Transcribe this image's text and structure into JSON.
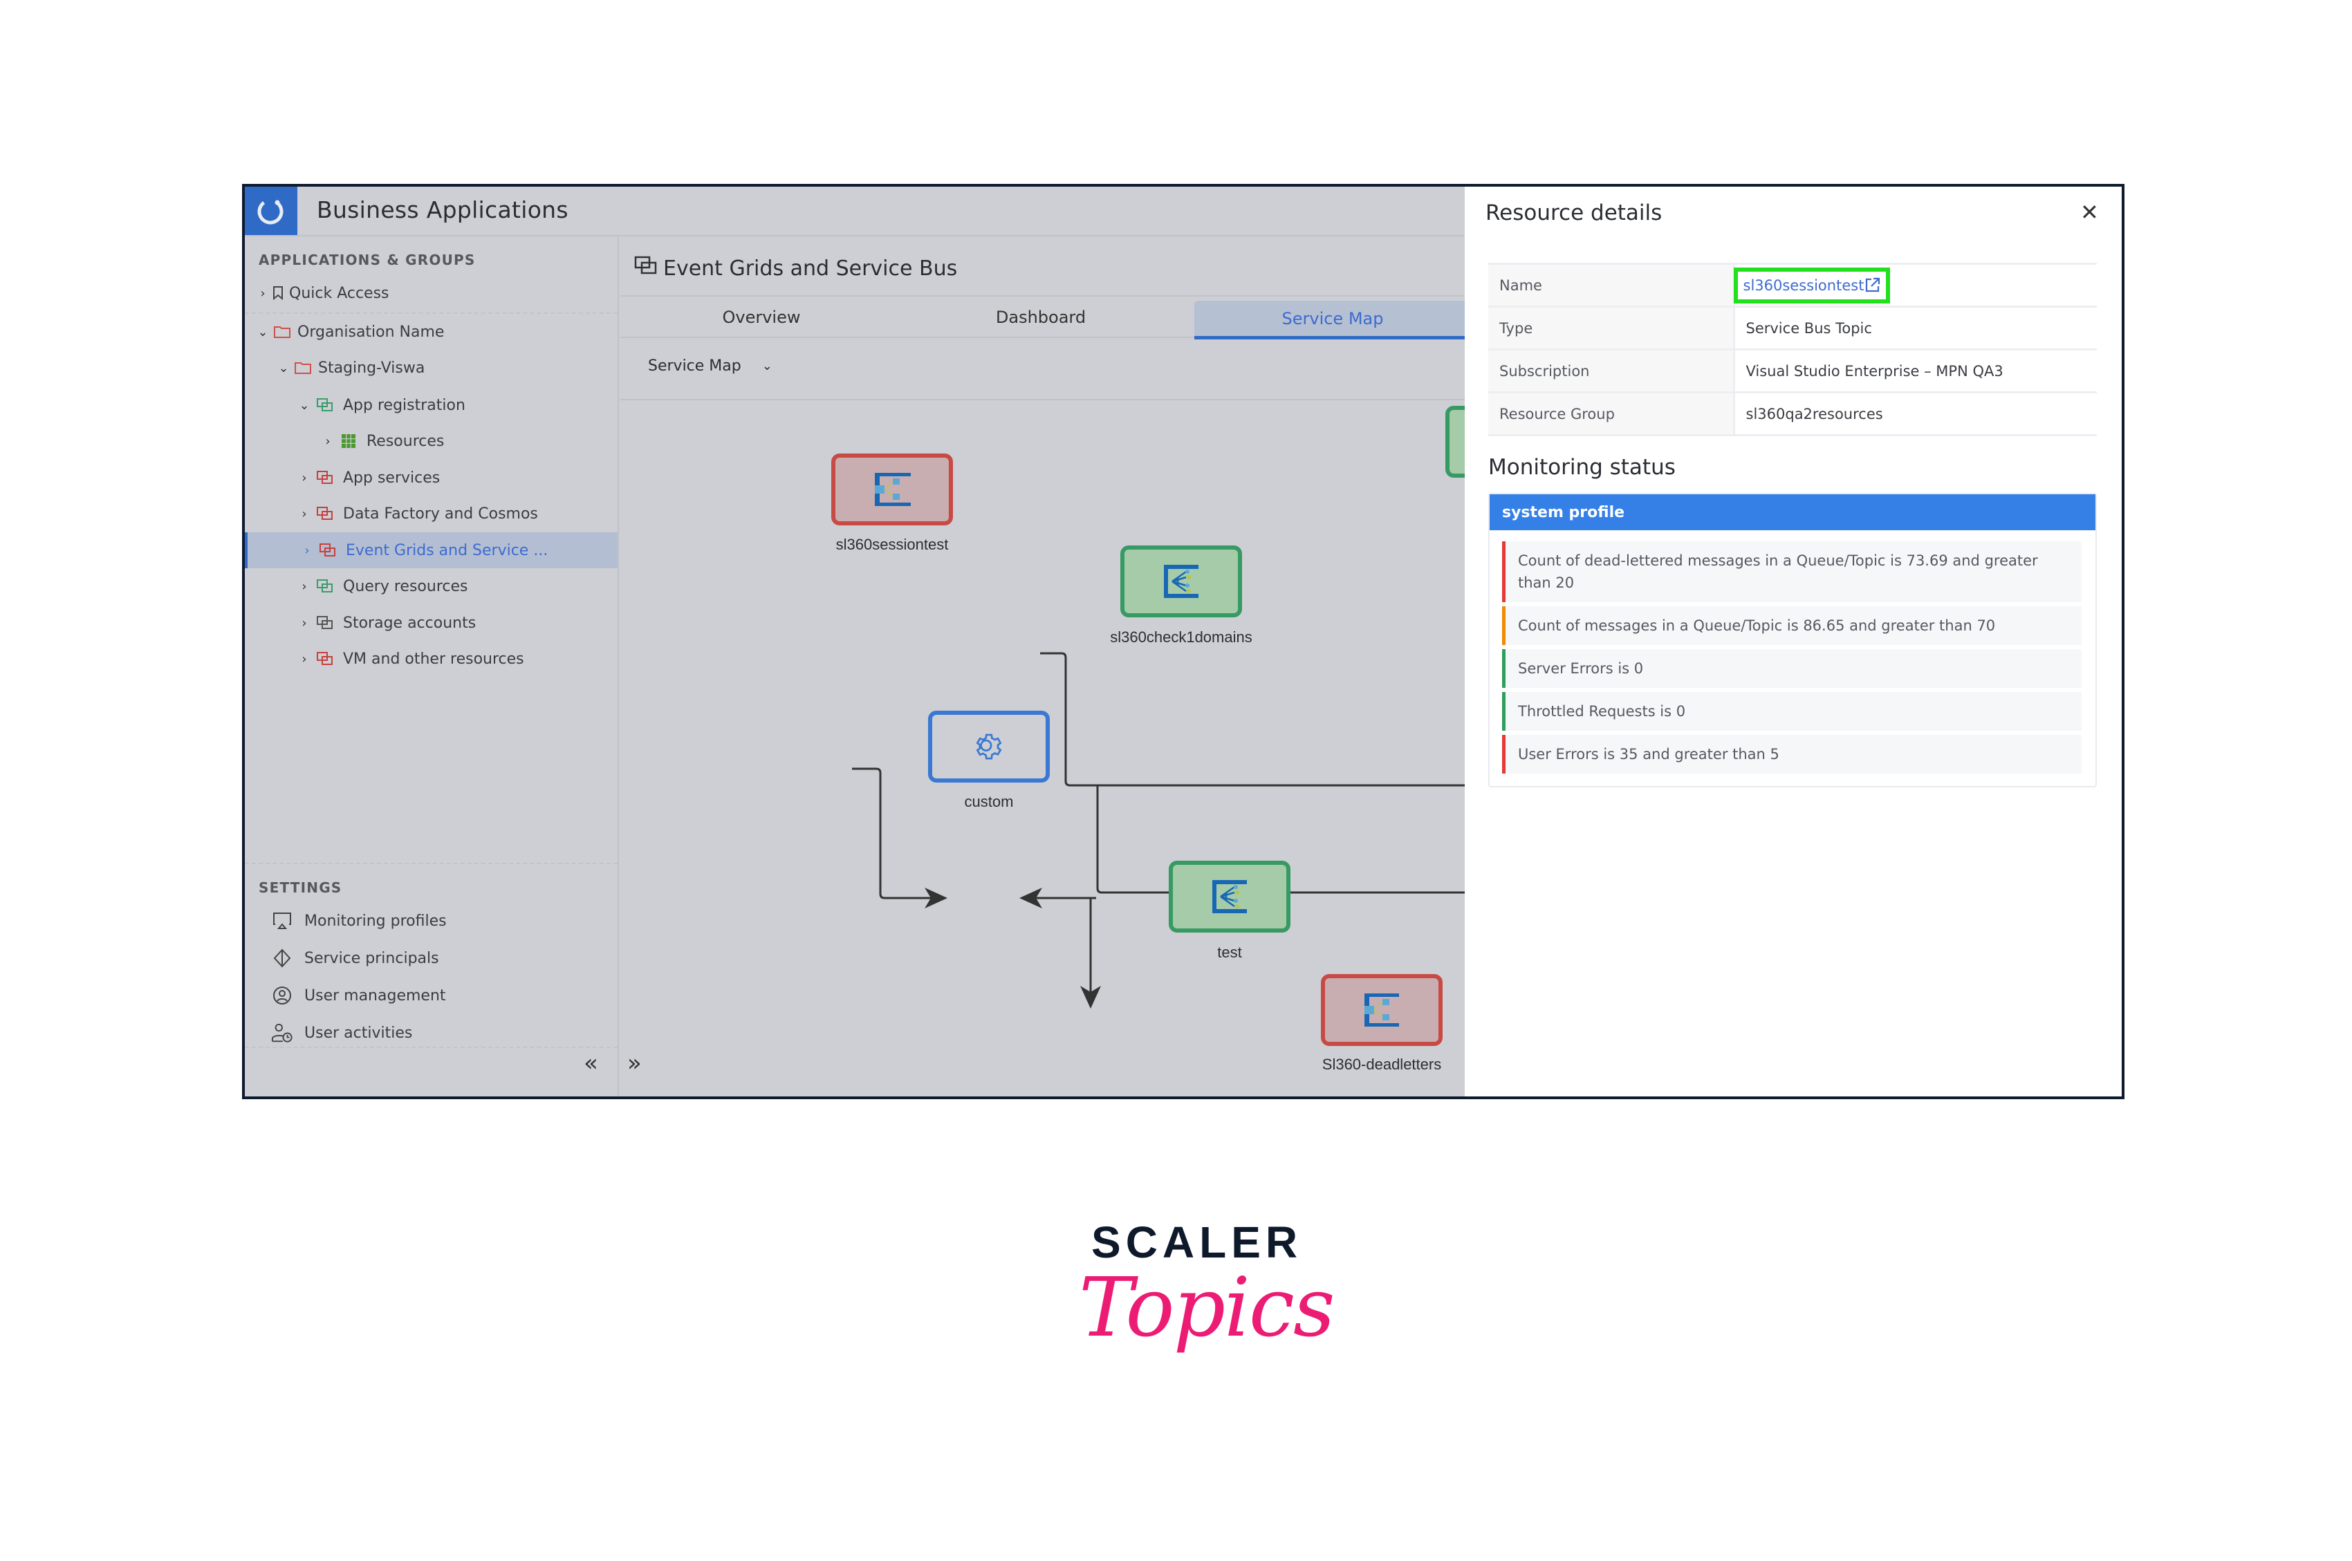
{
  "app": {
    "title": "Business Applications",
    "logo_icon": "refresh-circle-icon"
  },
  "sidebar": {
    "section_label": "APPLICATIONS & GROUPS",
    "tree": [
      {
        "label": "Quick Access",
        "icon": "bookmark-icon",
        "expanded": false,
        "level": 0
      },
      {
        "label": "Organisation Name",
        "icon": "folder-icon",
        "expanded": true,
        "level": 0
      },
      {
        "label": "Staging-Viswa",
        "icon": "folder-icon",
        "expanded": true,
        "level": 1
      },
      {
        "label": "App registration",
        "icon": "resource-group-icon",
        "status": "green",
        "expanded": true,
        "level": 2
      },
      {
        "label": "Resources",
        "icon": "grid-icon",
        "expanded": false,
        "level": 3
      },
      {
        "label": "App services",
        "icon": "resource-group-icon",
        "status": "red",
        "expanded": false,
        "level": 2
      },
      {
        "label": "Data Factory and Cosmos",
        "icon": "resource-group-icon",
        "status": "red",
        "expanded": false,
        "level": 2
      },
      {
        "label": "Event Grids and Service ...",
        "icon": "resource-group-icon",
        "status": "red",
        "expanded": false,
        "level": 2,
        "selected": true
      },
      {
        "label": "Query resources",
        "icon": "resource-group-icon",
        "status": "green",
        "expanded": false,
        "level": 2
      },
      {
        "label": "Storage accounts",
        "icon": "resource-group-icon",
        "status": "gray",
        "expanded": false,
        "level": 2
      },
      {
        "label": "VM and other resources",
        "icon": "resource-group-icon",
        "status": "red",
        "expanded": false,
        "level": 2
      }
    ],
    "settings_label": "SETTINGS",
    "settings": [
      {
        "label": "Monitoring profiles",
        "icon": "monitor-icon"
      },
      {
        "label": "Service principals",
        "icon": "diamond-icon"
      },
      {
        "label": "User management",
        "icon": "user-circle-icon"
      },
      {
        "label": "User activities",
        "icon": "user-clock-icon"
      }
    ],
    "collapse_label": "«"
  },
  "main": {
    "title": "Event Grids and Service Bus",
    "tabs": [
      {
        "label": "Overview",
        "active": false
      },
      {
        "label": "Dashboard",
        "active": false
      },
      {
        "label": "Service Map",
        "active": true
      }
    ],
    "view_select": {
      "value": "Service Map"
    },
    "expand_label": "»",
    "service_map": {
      "nodes": [
        {
          "id": "sl360sessiontest",
          "label": "sl360sessiontest",
          "kind": "service-bus-topic",
          "status": "red"
        },
        {
          "id": "sl360check1domains",
          "label": "sl360check1domains",
          "kind": "event-grid",
          "status": "green"
        },
        {
          "id": "custom",
          "label": "custom",
          "kind": "custom",
          "status": "blue"
        },
        {
          "id": "test",
          "label": "test",
          "kind": "event-grid",
          "status": "green"
        },
        {
          "id": "Sl360-deadletters",
          "label": "Sl360-deadletters",
          "kind": "service-bus-topic",
          "status": "red"
        },
        {
          "id": "offscreen",
          "label": "",
          "kind": "event-grid",
          "status": "green"
        }
      ],
      "edges": [
        {
          "from": "custom",
          "to": "test"
        },
        {
          "from": "sl360check1domains",
          "to": "test"
        },
        {
          "from": "sl360check1domains",
          "to": "Sl360-deadletters"
        }
      ]
    }
  },
  "details": {
    "title": "Resource details",
    "close_label": "✕",
    "properties": [
      {
        "key": "Name",
        "value": "sl360sessiontest",
        "link": true
      },
      {
        "key": "Type",
        "value": "Service Bus Topic"
      },
      {
        "key": "Subscription",
        "value": "Visual Studio Enterprise – MPN QA3"
      },
      {
        "key": "Resource Group",
        "value": "sl360qa2resources"
      }
    ],
    "monitoring_title": "Monitoring status",
    "profile_name": "system profile",
    "rules": [
      {
        "text": "Count of dead-lettered messages in a Queue/Topic is 73.69 and greater than 20",
        "severity": "critical",
        "color": "#e53935"
      },
      {
        "text": "Count of messages in a Queue/Topic is 86.65 and greater than 70",
        "severity": "warning",
        "color": "#f08a00"
      },
      {
        "text": "Server Errors is 0",
        "severity": "ok",
        "color": "#2e9e5e"
      },
      {
        "text": "Throttled Requests is 0",
        "severity": "ok",
        "color": "#2e9e5e"
      },
      {
        "text": "User Errors is 35 and greater than 5",
        "severity": "critical",
        "color": "#e53935"
      }
    ]
  },
  "colors": {
    "accent": "#2f6bc6",
    "profile_header": "#3580e6",
    "highlight_box": "#22e01c",
    "node_red": "#c84a45",
    "node_green": "#389a63",
    "node_blue": "#3a78d3"
  },
  "brand": {
    "line1": "SCALER",
    "line2": "Topics"
  }
}
